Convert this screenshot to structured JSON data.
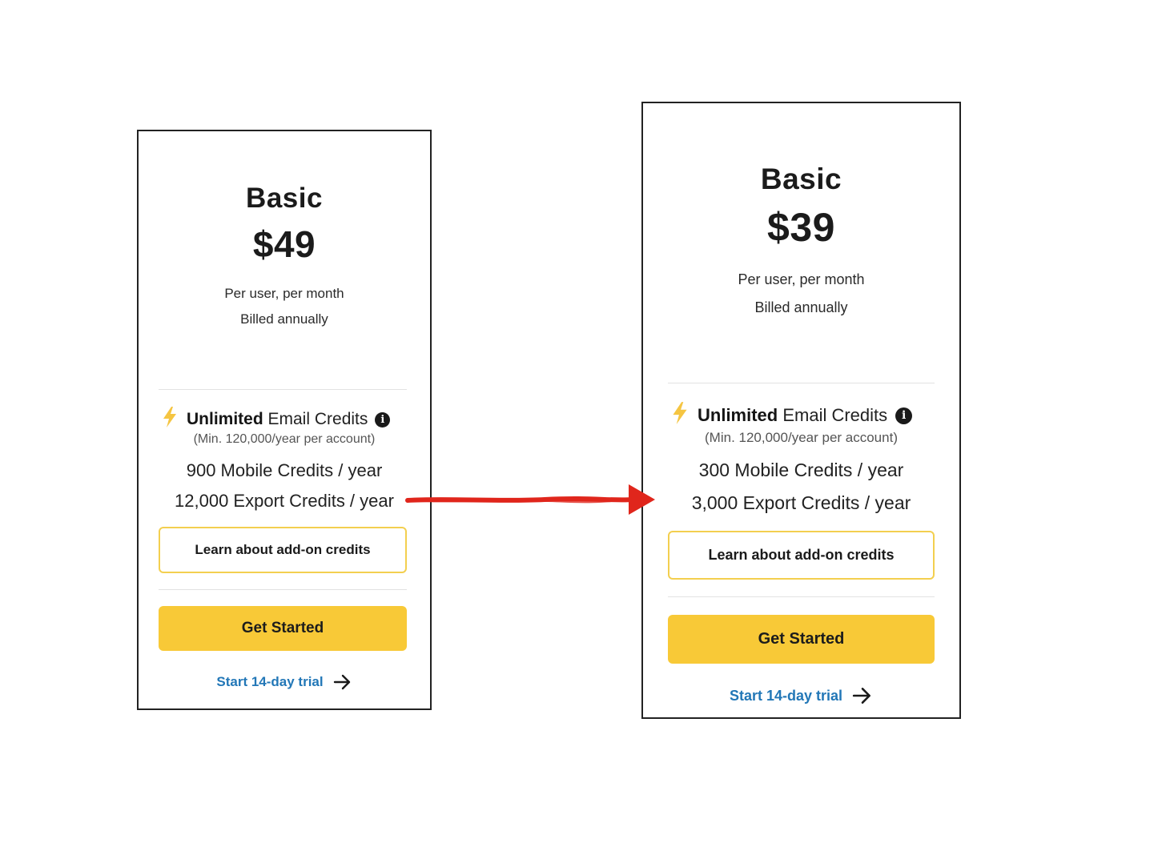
{
  "colors": {
    "accent_yellow": "#f8c937",
    "addon_border": "#f3cf4f",
    "link_blue": "#2277b7",
    "bolt_yellow": "#f5c542",
    "comparison_arrow_red": "#e0261c"
  },
  "cards": [
    {
      "plan_name": "Basic",
      "price": "$49",
      "billing_line_1": "Per user, per month",
      "billing_line_2": "Billed annually",
      "email_credits_bold": "Unlimited",
      "email_credits_rest": " Email Credits",
      "email_credits_note": "(Min. 120,000/year per account)",
      "mobile_credits": "900 Mobile Credits / year",
      "export_credits": "12,000 Export Credits / year",
      "addon_button_label": "Learn about add-on credits",
      "cta_label": "Get Started",
      "trial_link_label": "Start 14-day trial",
      "icons": [
        "lightning-bolt-icon",
        "info-icon",
        "arrow-right-icon"
      ]
    },
    {
      "plan_name": "Basic",
      "price": "$39",
      "billing_line_1": "Per user, per month",
      "billing_line_2": "Billed annually",
      "email_credits_bold": "Unlimited",
      "email_credits_rest": " Email Credits",
      "email_credits_note": "(Min. 120,000/year per account)",
      "mobile_credits": "300 Mobile Credits / year",
      "export_credits": "3,000 Export Credits / year",
      "addon_button_label": "Learn about add-on credits",
      "cta_label": "Get Started",
      "trial_link_label": "Start 14-day trial",
      "icons": [
        "lightning-bolt-icon",
        "info-icon",
        "arrow-right-icon"
      ]
    }
  ],
  "annotation": {
    "icon": "red-arrow-icon"
  }
}
